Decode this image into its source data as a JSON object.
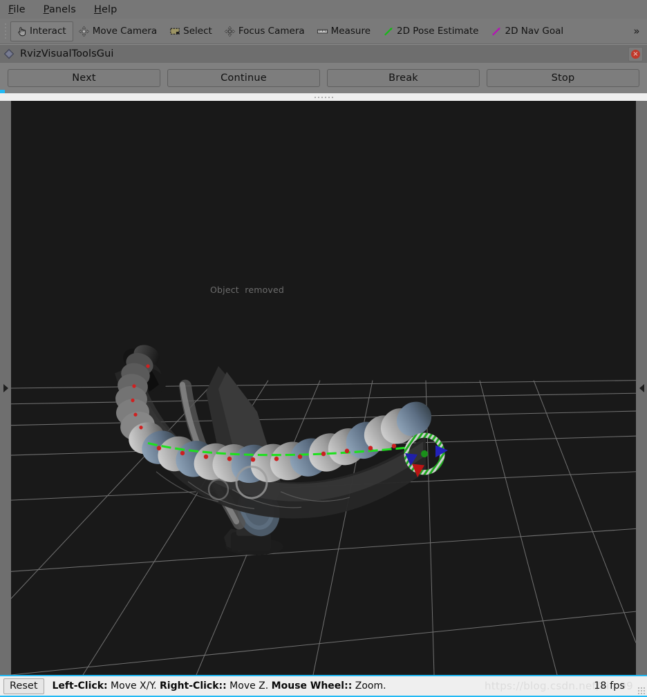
{
  "menubar": {
    "items": [
      {
        "label": "File",
        "accel": "F"
      },
      {
        "label": "Panels",
        "accel": "P"
      },
      {
        "label": "Help",
        "accel": "H"
      }
    ]
  },
  "toolbar": {
    "tools": [
      {
        "label": "Interact",
        "icon": "hand-pointer-icon",
        "active": true
      },
      {
        "label": "Move Camera",
        "icon": "move-camera-icon",
        "active": false
      },
      {
        "label": "Select",
        "icon": "select-rect-icon",
        "active": false
      },
      {
        "label": "Focus Camera",
        "icon": "focus-camera-icon",
        "active": false
      },
      {
        "label": "Measure",
        "icon": "ruler-icon",
        "active": false
      },
      {
        "label": "2D Pose Estimate",
        "icon": "green-arrow-icon",
        "active": false
      },
      {
        "label": "2D Nav Goal",
        "icon": "magenta-arrow-icon",
        "active": false
      }
    ],
    "overflow_label": "»"
  },
  "panel": {
    "title": "RvizVisualToolsGui",
    "icon": "diamond-icon",
    "close_label": "×",
    "buttons": [
      {
        "label": "Next"
      },
      {
        "label": "Continue"
      },
      {
        "label": "Break"
      },
      {
        "label": "Stop"
      }
    ]
  },
  "viewport": {
    "overlay_text": "Object  removed",
    "left_splitter_icon": "chevron-right-icon",
    "right_splitter_icon": "chevron-left-icon",
    "colors": {
      "background": "#191919",
      "grid_line": "#8a8a8a",
      "marker_ring": "#1faa1f",
      "axis_arrow": "#16e016",
      "cone_blue": "#2222aa",
      "cone_red": "#aa1111"
    }
  },
  "statusbar": {
    "reset_label": "Reset",
    "hints": [
      {
        "bold": "Left-Click:",
        "normal": " Move X/Y. "
      },
      {
        "bold": "Right-Click::",
        "normal": " Move Z. "
      },
      {
        "bold": "Mouse Wheel::",
        "normal": " Zoom."
      }
    ],
    "fps": "18 fps",
    "watermark": "https://blog.csdn.net/xia        99",
    "accent_color": "#22baf5"
  }
}
